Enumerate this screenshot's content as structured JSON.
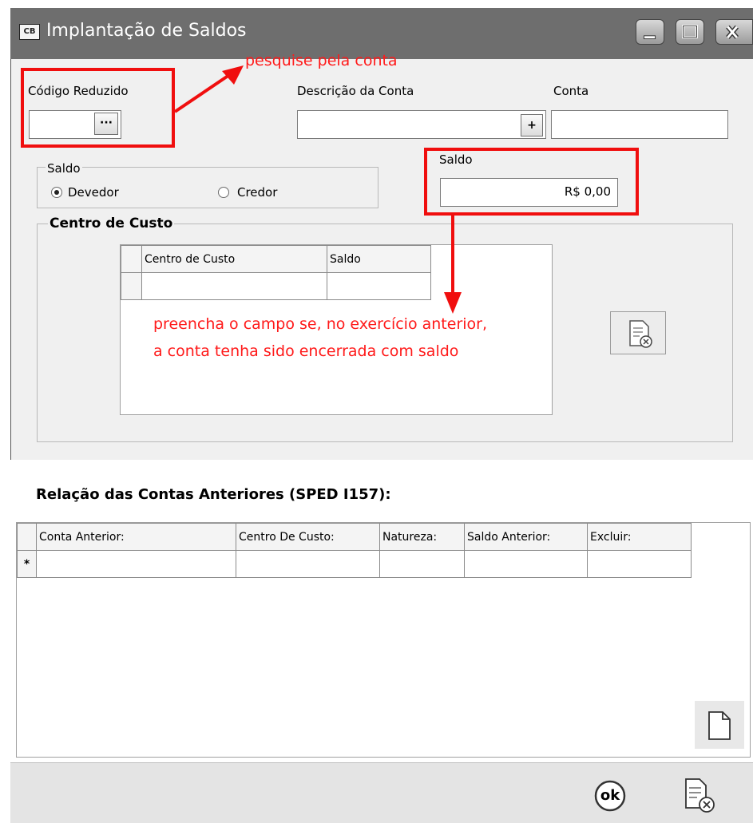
{
  "window": {
    "icon_text": "CB",
    "title": "Implantação de Saldos"
  },
  "fields": {
    "codigo_reduzido_label": "Código Reduzido",
    "codigo_reduzido_button": "···",
    "descricao_label": "Descrição da Conta",
    "descricao_button": "+",
    "conta_label": "Conta",
    "saldo_label": "Saldo",
    "saldo_value": "R$ 0,00"
  },
  "saldo_group": {
    "title": "Saldo",
    "options": [
      "Devedor",
      "Credor"
    ],
    "selected": "Devedor"
  },
  "centro_custo": {
    "title": "Centro de Custo",
    "columns": [
      "Centro de Custo",
      "Saldo"
    ]
  },
  "annotations": {
    "search_hint": "pesquise pela conta",
    "fill_hint_line1": "preencha o campo se, no exercício anterior,",
    "fill_hint_line2": "a conta tenha sido encerrada com saldo"
  },
  "relacao": {
    "title": "Relação das Contas Anteriores (SPED I157):",
    "columns": [
      "Conta Anterior:",
      "Centro De Custo:",
      "Natureza:",
      "Saldo Anterior:",
      "Excluir:"
    ],
    "new_row_marker": "*"
  },
  "footer": {
    "ok_label": "ok"
  },
  "colors": {
    "titlebar": "#6e6e6e",
    "annotation": "#ff1a1a",
    "window_bg": "#f0f0f0"
  }
}
